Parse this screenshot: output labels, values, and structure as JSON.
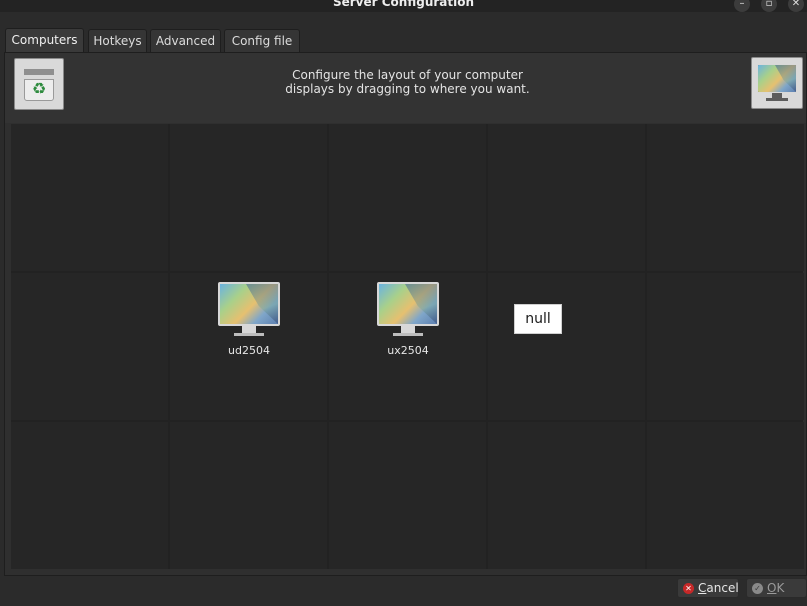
{
  "window": {
    "title": "Server Configuration",
    "controls": {
      "minimize": "–",
      "maximize": "▫",
      "close": "✕"
    }
  },
  "tabs": [
    {
      "label": "Computers",
      "active": true
    },
    {
      "label": "Hotkeys",
      "active": false
    },
    {
      "label": "Advanced",
      "active": false
    },
    {
      "label": "Config file",
      "active": false
    }
  ],
  "header": {
    "instructions_line1": "Configure the layout of your computer",
    "instructions_line2": "displays by dragging to where you want.",
    "trash_icon": "recycle-bin-icon",
    "new_screen_icon": "monitor-icon"
  },
  "screens": [
    {
      "name": "ud2504"
    },
    {
      "name": "ux2504"
    }
  ],
  "tooltip": {
    "text": "null"
  },
  "buttons": {
    "cancel": {
      "label_first": "C",
      "label_rest": "ancel",
      "icon": "cancel-icon"
    },
    "ok": {
      "label_first": "O",
      "label_rest": "K",
      "icon": "ok-icon",
      "enabled": false
    }
  },
  "colors": {
    "window_bg": "#2b2b2b",
    "grid_cell": "#262626",
    "cancel_icon": "#c62828"
  }
}
